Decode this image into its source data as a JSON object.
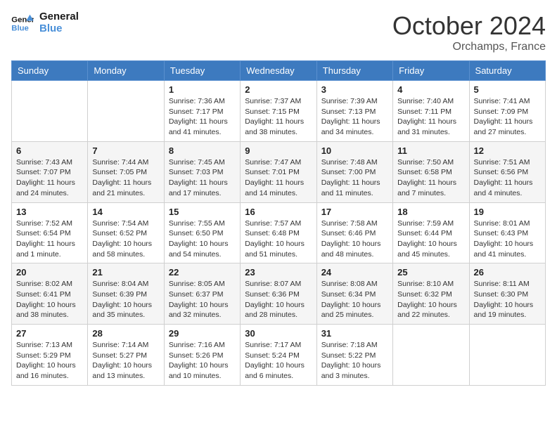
{
  "header": {
    "logo_line1": "General",
    "logo_line2": "Blue",
    "month": "October 2024",
    "location": "Orchamps, France"
  },
  "weekdays": [
    "Sunday",
    "Monday",
    "Tuesday",
    "Wednesday",
    "Thursday",
    "Friday",
    "Saturday"
  ],
  "weeks": [
    [
      {
        "day": "",
        "info": ""
      },
      {
        "day": "",
        "info": ""
      },
      {
        "day": "1",
        "info": "Sunrise: 7:36 AM\nSunset: 7:17 PM\nDaylight: 11 hours and 41 minutes."
      },
      {
        "day": "2",
        "info": "Sunrise: 7:37 AM\nSunset: 7:15 PM\nDaylight: 11 hours and 38 minutes."
      },
      {
        "day": "3",
        "info": "Sunrise: 7:39 AM\nSunset: 7:13 PM\nDaylight: 11 hours and 34 minutes."
      },
      {
        "day": "4",
        "info": "Sunrise: 7:40 AM\nSunset: 7:11 PM\nDaylight: 11 hours and 31 minutes."
      },
      {
        "day": "5",
        "info": "Sunrise: 7:41 AM\nSunset: 7:09 PM\nDaylight: 11 hours and 27 minutes."
      }
    ],
    [
      {
        "day": "6",
        "info": "Sunrise: 7:43 AM\nSunset: 7:07 PM\nDaylight: 11 hours and 24 minutes."
      },
      {
        "day": "7",
        "info": "Sunrise: 7:44 AM\nSunset: 7:05 PM\nDaylight: 11 hours and 21 minutes."
      },
      {
        "day": "8",
        "info": "Sunrise: 7:45 AM\nSunset: 7:03 PM\nDaylight: 11 hours and 17 minutes."
      },
      {
        "day": "9",
        "info": "Sunrise: 7:47 AM\nSunset: 7:01 PM\nDaylight: 11 hours and 14 minutes."
      },
      {
        "day": "10",
        "info": "Sunrise: 7:48 AM\nSunset: 7:00 PM\nDaylight: 11 hours and 11 minutes."
      },
      {
        "day": "11",
        "info": "Sunrise: 7:50 AM\nSunset: 6:58 PM\nDaylight: 11 hours and 7 minutes."
      },
      {
        "day": "12",
        "info": "Sunrise: 7:51 AM\nSunset: 6:56 PM\nDaylight: 11 hours and 4 minutes."
      }
    ],
    [
      {
        "day": "13",
        "info": "Sunrise: 7:52 AM\nSunset: 6:54 PM\nDaylight: 11 hours and 1 minute."
      },
      {
        "day": "14",
        "info": "Sunrise: 7:54 AM\nSunset: 6:52 PM\nDaylight: 10 hours and 58 minutes."
      },
      {
        "day": "15",
        "info": "Sunrise: 7:55 AM\nSunset: 6:50 PM\nDaylight: 10 hours and 54 minutes."
      },
      {
        "day": "16",
        "info": "Sunrise: 7:57 AM\nSunset: 6:48 PM\nDaylight: 10 hours and 51 minutes."
      },
      {
        "day": "17",
        "info": "Sunrise: 7:58 AM\nSunset: 6:46 PM\nDaylight: 10 hours and 48 minutes."
      },
      {
        "day": "18",
        "info": "Sunrise: 7:59 AM\nSunset: 6:44 PM\nDaylight: 10 hours and 45 minutes."
      },
      {
        "day": "19",
        "info": "Sunrise: 8:01 AM\nSunset: 6:43 PM\nDaylight: 10 hours and 41 minutes."
      }
    ],
    [
      {
        "day": "20",
        "info": "Sunrise: 8:02 AM\nSunset: 6:41 PM\nDaylight: 10 hours and 38 minutes."
      },
      {
        "day": "21",
        "info": "Sunrise: 8:04 AM\nSunset: 6:39 PM\nDaylight: 10 hours and 35 minutes."
      },
      {
        "day": "22",
        "info": "Sunrise: 8:05 AM\nSunset: 6:37 PM\nDaylight: 10 hours and 32 minutes."
      },
      {
        "day": "23",
        "info": "Sunrise: 8:07 AM\nSunset: 6:36 PM\nDaylight: 10 hours and 28 minutes."
      },
      {
        "day": "24",
        "info": "Sunrise: 8:08 AM\nSunset: 6:34 PM\nDaylight: 10 hours and 25 minutes."
      },
      {
        "day": "25",
        "info": "Sunrise: 8:10 AM\nSunset: 6:32 PM\nDaylight: 10 hours and 22 minutes."
      },
      {
        "day": "26",
        "info": "Sunrise: 8:11 AM\nSunset: 6:30 PM\nDaylight: 10 hours and 19 minutes."
      }
    ],
    [
      {
        "day": "27",
        "info": "Sunrise: 7:13 AM\nSunset: 5:29 PM\nDaylight: 10 hours and 16 minutes."
      },
      {
        "day": "28",
        "info": "Sunrise: 7:14 AM\nSunset: 5:27 PM\nDaylight: 10 hours and 13 minutes."
      },
      {
        "day": "29",
        "info": "Sunrise: 7:16 AM\nSunset: 5:26 PM\nDaylight: 10 hours and 10 minutes."
      },
      {
        "day": "30",
        "info": "Sunrise: 7:17 AM\nSunset: 5:24 PM\nDaylight: 10 hours and 6 minutes."
      },
      {
        "day": "31",
        "info": "Sunrise: 7:18 AM\nSunset: 5:22 PM\nDaylight: 10 hours and 3 minutes."
      },
      {
        "day": "",
        "info": ""
      },
      {
        "day": "",
        "info": ""
      }
    ]
  ]
}
